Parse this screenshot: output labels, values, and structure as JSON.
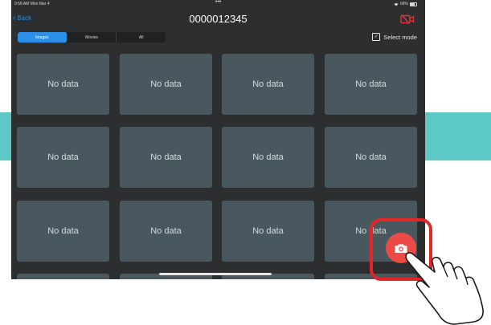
{
  "status_bar": {
    "time": "9:58 AM  Mon Mar 4",
    "dots": "•••",
    "battery": "68%"
  },
  "nav": {
    "back_label": "Back",
    "title": "0000012345",
    "camera_off_icon": "camera-off-icon"
  },
  "segments": [
    {
      "label": "Images",
      "active": true
    },
    {
      "label": "Movies",
      "active": false
    },
    {
      "label": "All",
      "active": false
    }
  ],
  "select_mode": {
    "label": "Select mode",
    "checked": true
  },
  "tiles": [
    {
      "text": "No data"
    },
    {
      "text": "No data"
    },
    {
      "text": "No data"
    },
    {
      "text": "No data"
    },
    {
      "text": "No data"
    },
    {
      "text": "No data"
    },
    {
      "text": "No data"
    },
    {
      "text": "No data"
    },
    {
      "text": "No data"
    },
    {
      "text": "No data"
    },
    {
      "text": "No data"
    },
    {
      "text": "No data"
    }
  ],
  "fab": {
    "icon": "camera-icon"
  },
  "colors": {
    "background": "#2c2e30",
    "tile": "#49585e",
    "accent_blue": "#2b8fe8",
    "fab_red": "#ec4b45",
    "highlight_red": "#e52428",
    "teal_band": "#5cc9c6"
  }
}
